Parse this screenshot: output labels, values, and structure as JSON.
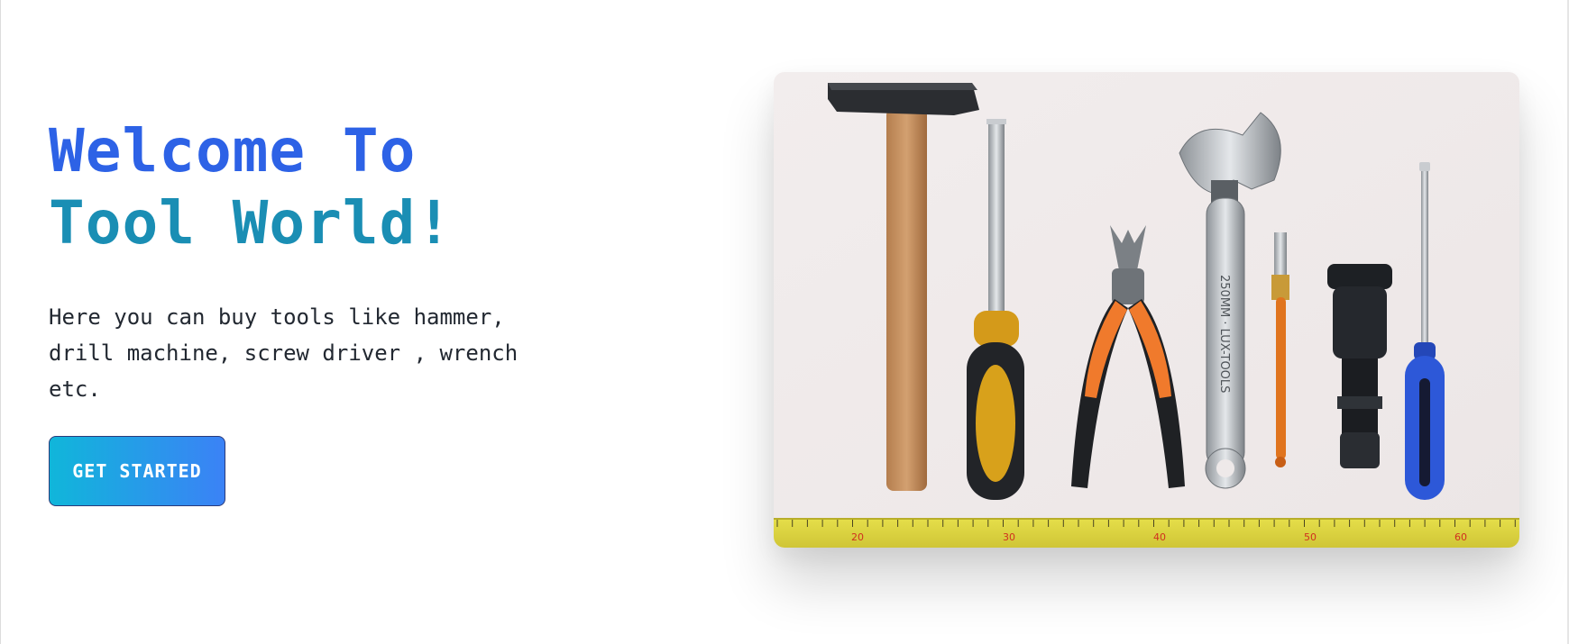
{
  "hero": {
    "title_line1": "Welcome To",
    "title_line2": "Tool World!",
    "description": "Here you can buy tools like hammer, drill machine, screw driver , wrench etc.",
    "cta_label": "GET STARTED"
  },
  "image": {
    "wrench_engraving": "250MM · LUX-TOOLS",
    "ruler_major_marks": [
      "20",
      "30",
      "40",
      "50",
      "60"
    ]
  },
  "colors": {
    "title_blue": "#2d62e6",
    "title_teal": "#1a8eb4",
    "cta_start": "#10b6da",
    "cta_end": "#3b82f6"
  }
}
